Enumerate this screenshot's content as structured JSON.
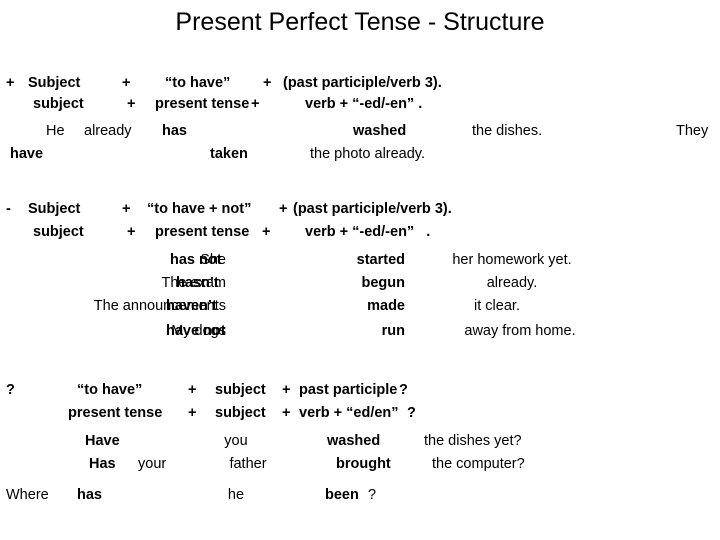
{
  "slide": {
    "title": "Present Perfect Tense - Structure",
    "background": "#ffffff",
    "text_color": "#000000"
  },
  "affirmative": {
    "marker": "+",
    "formula_line": {
      "subject": "Subject",
      "plus1": "+",
      "aux": "“to have”",
      "plus2": "+",
      "verb": "(past participle/verb 3)."
    },
    "explain_line": {
      "subject": "subject",
      "plus1": "+",
      "aux": "present tense",
      "plus2": "+",
      "verb": "verb + “-ed/-en” ."
    },
    "examples": [
      {
        "subject": "He",
        "adverb": "already",
        "aux": "has",
        "verb": "washed",
        "object": "the dishes.",
        "trailing": "They"
      },
      {
        "subject": "",
        "adverb": "",
        "aux": "have",
        "verb": "taken",
        "object": "the photo already.",
        "trailing": ""
      }
    ]
  },
  "negative": {
    "marker": "-",
    "formula_line": {
      "subject": "Subject",
      "plus1": "+",
      "aux": "“to have + not”",
      "plus2": "+",
      "verb": "(past participle/verb 3)."
    },
    "explain_line": {
      "subject": "subject",
      "plus1": "+",
      "aux": "present tense",
      "plus2": "+",
      "verb": "verb + “-ed/-en”   ."
    },
    "examples": [
      {
        "subject": "She",
        "aux": "has not",
        "verb": "started",
        "object": "her homework yet."
      },
      {
        "subject": "The exam",
        "aux": "hasn’t",
        "verb": "begun",
        "object": "already."
      },
      {
        "subject": "The announcements",
        "aux": "haven’t",
        "verb": "made",
        "object": "it clear."
      },
      {
        "subject": "My dogs",
        "aux": "have not",
        "verb": "run",
        "object": "away from home."
      }
    ]
  },
  "question": {
    "marker": "?",
    "formula_line": {
      "aux": "“to have”",
      "plus1": "+",
      "subject": "subject",
      "plus2": "+",
      "verb": "past participle",
      "qmark": "?"
    },
    "explain_line": {
      "aux": "present tense",
      "plus1": "+",
      "subject": "subject",
      "plus2": "+",
      "verb": "verb + “ed/en”",
      "qmark": "?"
    },
    "examples": [
      {
        "wh": "",
        "aux": "Have",
        "det": "",
        "subject": "you",
        "verb": "washed",
        "object": "the dishes yet?"
      },
      {
        "wh": "",
        "aux": "Has",
        "det": "your",
        "subject": "father",
        "verb": "brought",
        "object": "the computer?"
      },
      {
        "wh": "Where",
        "aux": "has",
        "det": "",
        "subject": "he",
        "verb": "been",
        "object": "?"
      }
    ]
  }
}
